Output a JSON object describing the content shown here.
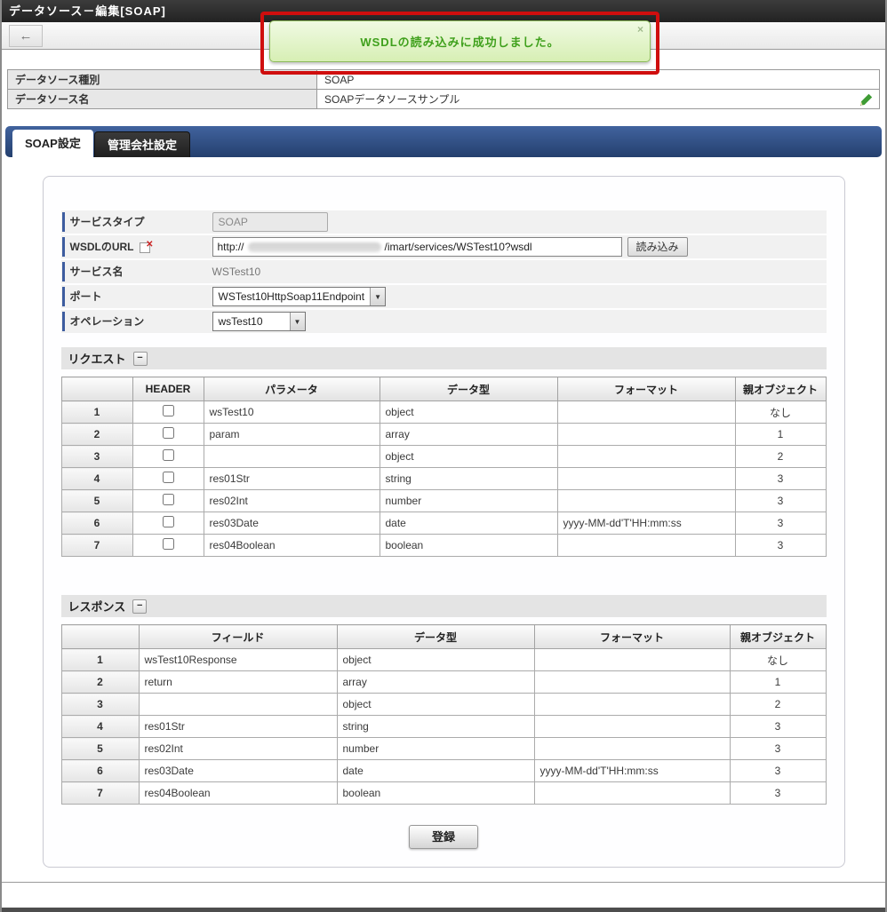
{
  "window": {
    "title": "データソース－編集[SOAP]"
  },
  "toolbar": {
    "back_label": "←"
  },
  "notification": {
    "message": "WSDLの読み込みに成功しました。",
    "close_label": "×"
  },
  "datasource": {
    "type_label": "データソース種別",
    "type_value": "SOAP",
    "name_label": "データソース名",
    "name_value": "SOAPデータソースサンプル"
  },
  "tabs": {
    "soap": "SOAP設定",
    "admin": "管理会社設定"
  },
  "form": {
    "service_type_label": "サービスタイプ",
    "service_type_value": "SOAP",
    "wsdl_url_label": "WSDLのURL",
    "wsdl_url_prefix": "http://",
    "wsdl_url_suffix": "/imart/services/WSTest10?wsdl",
    "load_button": "読み込み",
    "service_name_label": "サービス名",
    "service_name_value": "WSTest10",
    "port_label": "ポート",
    "port_value": "WSTest10HttpSoap11Endpoint",
    "operation_label": "オペレーション",
    "operation_value": "wsTest10"
  },
  "request": {
    "title": "リクエスト",
    "collapse_label": "−",
    "headers": {
      "header": "HEADER",
      "param": "パラメータ",
      "type": "データ型",
      "format": "フォーマット",
      "parent": "親オブジェクト"
    },
    "rows": [
      {
        "num": "1",
        "param": "wsTest10",
        "type": "object",
        "format": "",
        "parent": "なし"
      },
      {
        "num": "2",
        "param": "param",
        "type": "array",
        "format": "",
        "parent": "1"
      },
      {
        "num": "3",
        "param": "",
        "type": "object",
        "format": "",
        "parent": "2"
      },
      {
        "num": "4",
        "param": "res01Str",
        "type": "string",
        "format": "",
        "parent": "3"
      },
      {
        "num": "5",
        "param": "res02Int",
        "type": "number",
        "format": "",
        "parent": "3"
      },
      {
        "num": "6",
        "param": "res03Date",
        "type": "date",
        "format": "yyyy-MM-dd'T'HH:mm:ss",
        "parent": "3"
      },
      {
        "num": "7",
        "param": "res04Boolean",
        "type": "boolean",
        "format": "",
        "parent": "3"
      }
    ]
  },
  "response": {
    "title": "レスポンス",
    "collapse_label": "−",
    "headers": {
      "field": "フィールド",
      "type": "データ型",
      "format": "フォーマット",
      "parent": "親オブジェクト"
    },
    "rows": [
      {
        "num": "1",
        "field": "wsTest10Response",
        "type": "object",
        "format": "",
        "parent": "なし"
      },
      {
        "num": "2",
        "field": "return",
        "type": "array",
        "format": "",
        "parent": "1"
      },
      {
        "num": "3",
        "field": "",
        "type": "object",
        "format": "",
        "parent": "2"
      },
      {
        "num": "4",
        "field": "res01Str",
        "type": "string",
        "format": "",
        "parent": "3"
      },
      {
        "num": "5",
        "field": "res02Int",
        "type": "number",
        "format": "",
        "parent": "3"
      },
      {
        "num": "6",
        "field": "res03Date",
        "type": "date",
        "format": "yyyy-MM-dd'T'HH:mm:ss",
        "parent": "3"
      },
      {
        "num": "7",
        "field": "res04Boolean",
        "type": "boolean",
        "format": "",
        "parent": "3"
      }
    ]
  },
  "submit": {
    "label": "登録"
  },
  "colors": {
    "accent_blue": "#3d5c9f",
    "success_green": "#3fa01c",
    "annotation_red": "#cf0e0e"
  }
}
